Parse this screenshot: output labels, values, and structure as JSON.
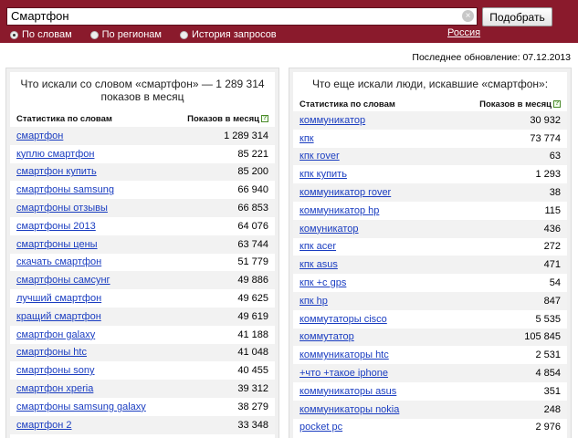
{
  "search": {
    "value": "Смартфон",
    "clear_glyph": "×",
    "submit_label": "Подобрать"
  },
  "modes": [
    {
      "label": "По словам",
      "checked": true
    },
    {
      "label": "По регионам",
      "checked": false
    },
    {
      "label": "История запросов",
      "checked": false
    }
  ],
  "region_link": "Россия",
  "updated": "Последнее обновление: 07.12.2013",
  "left_panel": {
    "title": "Что искали со словом «смартфон» — 1 289 314 показов в месяц",
    "col_word": "Статистика по словам",
    "col_count": "Показов в месяц",
    "help_glyph": "?",
    "rows": [
      {
        "word": "смартфон",
        "count": "1 289 314"
      },
      {
        "word": "куплю смартфон",
        "count": "85 221"
      },
      {
        "word": "смартфон купить",
        "count": "85 200"
      },
      {
        "word": "смартфоны samsung",
        "count": "66 940"
      },
      {
        "word": "смартфоны отзывы",
        "count": "66 853"
      },
      {
        "word": "смартфоны 2013",
        "count": "64 076"
      },
      {
        "word": "смартфоны цены",
        "count": "63 744"
      },
      {
        "word": "скачать смартфон",
        "count": "51 779"
      },
      {
        "word": "смартфоны самсунг",
        "count": "49 886"
      },
      {
        "word": "лучший смартфон",
        "count": "49 625"
      },
      {
        "word": "кращий смартфон",
        "count": "49 619"
      },
      {
        "word": "смартфон galaxy",
        "count": "41 188"
      },
      {
        "word": "смартфоны htc",
        "count": "41 048"
      },
      {
        "word": "смартфоны sony",
        "count": "40 455"
      },
      {
        "word": "смартфон xperia",
        "count": "39 312"
      },
      {
        "word": "смартфоны samsung galaxy",
        "count": "38 279"
      },
      {
        "word": "смартфон 2",
        "count": "33 348"
      }
    ]
  },
  "right_panel": {
    "title": "Что еще искали люди, искавшие «смартфон»:",
    "col_word": "Статистика по словам",
    "col_count": "Показов в месяц",
    "help_glyph": "?",
    "rows": [
      {
        "word": "коммуникатор",
        "count": "30 932"
      },
      {
        "word": "кпк",
        "count": "73 774"
      },
      {
        "word": "кпк rover",
        "count": "63"
      },
      {
        "word": "кпк купить",
        "count": "1 293"
      },
      {
        "word": "коммуникатор rover",
        "count": "38"
      },
      {
        "word": "коммуникатор hp",
        "count": "115"
      },
      {
        "word": "комуникатор",
        "count": "436"
      },
      {
        "word": "кпк acer",
        "count": "272"
      },
      {
        "word": "кпк asus",
        "count": "471"
      },
      {
        "word": "кпк +с gps",
        "count": "54"
      },
      {
        "word": "кпк hp",
        "count": "847"
      },
      {
        "word": "коммутаторы cisco",
        "count": "5 535"
      },
      {
        "word": "коммутатор",
        "count": "105 845"
      },
      {
        "word": "коммуникаторы htc",
        "count": "2 531"
      },
      {
        "word": "+что +такое iphone",
        "count": "4 854"
      },
      {
        "word": "коммуникаторы asus",
        "count": "351"
      },
      {
        "word": "коммуникаторы nokia",
        "count": "248"
      },
      {
        "word": "pocket pc",
        "count": "2 976"
      }
    ]
  }
}
